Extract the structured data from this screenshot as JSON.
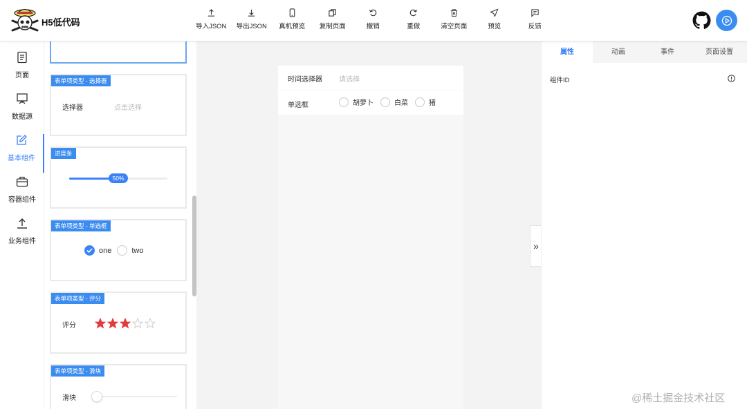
{
  "header": {
    "brand": "H5低代码",
    "toolbar": [
      {
        "icon": "upload-icon",
        "label": "导入JSON"
      },
      {
        "icon": "download-icon",
        "label": "导出JSON"
      },
      {
        "icon": "phone-icon",
        "label": "真机预览"
      },
      {
        "icon": "copy-icon",
        "label": "复制页面"
      },
      {
        "icon": "undo-icon",
        "label": "撤销"
      },
      {
        "icon": "redo-icon",
        "label": "重做"
      },
      {
        "icon": "trash-icon",
        "label": "清空页面"
      },
      {
        "icon": "send-icon",
        "label": "预览"
      },
      {
        "icon": "feedback-icon",
        "label": "反馈"
      }
    ]
  },
  "leftnav": {
    "items": [
      {
        "icon": "page-icon",
        "label": "页面"
      },
      {
        "icon": "datasource-icon",
        "label": "数据源"
      },
      {
        "icon": "edit-icon",
        "label": "基本组件"
      },
      {
        "icon": "briefcase-icon",
        "label": "容器组件"
      },
      {
        "icon": "upload-icon",
        "label": "业务组件"
      }
    ],
    "active_index": 2
  },
  "components": {
    "picker": {
      "tag": "表单项类型 - 选择器",
      "label": "选择器",
      "placeholder": "点击选择"
    },
    "progress": {
      "tag": "进度条",
      "value_text": "50%",
      "value": 0.5
    },
    "radio": {
      "tag": "表单项类型 - 单选框",
      "options": [
        "one",
        "two"
      ],
      "selected": "one"
    },
    "rate": {
      "tag": "表单项类型 - 评分",
      "label": "评分",
      "value": 3,
      "max": 5
    },
    "slider": {
      "tag": "表单项类型 - 滑块",
      "label": "滑块",
      "value": 0
    }
  },
  "canvas": {
    "time_picker": {
      "label": "时间选择器",
      "placeholder": "请选择"
    },
    "radio": {
      "label": "单选框",
      "options": [
        "胡萝卜",
        "白菜",
        "猪"
      ]
    }
  },
  "rightpanel": {
    "tabs": [
      "属性",
      "动画",
      "事件",
      "页面设置"
    ],
    "active_tab": "属性",
    "field_label": "组件ID",
    "collapse_glyph": "»"
  },
  "watermark": "@稀土掘金技术社区",
  "colors": {
    "accent": "#3b8cf0",
    "star": "#e03d3d",
    "tab_active": "#3b82f6"
  }
}
